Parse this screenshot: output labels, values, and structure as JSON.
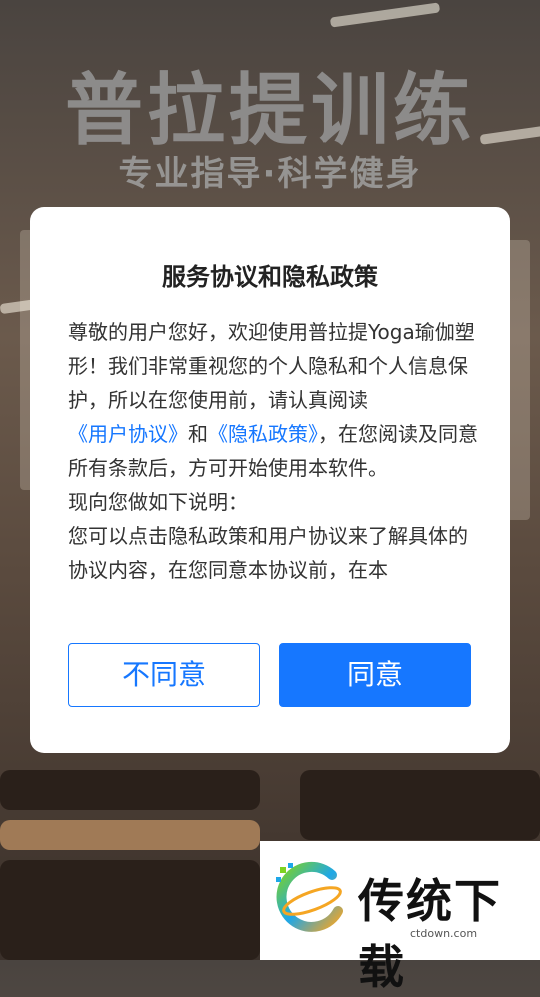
{
  "hero": {
    "title": "普拉提训练",
    "subtitle": "专业指导·科学健身"
  },
  "dialog": {
    "title": "服务协议和隐私政策",
    "paragraph1_a": "尊敬的用户您好，欢迎使用普拉提Yoga瑜伽塑形！我们非常重视您的个人隐私和个人信息保护，所以在您使用前，请认真阅读",
    "user_agreement_link": "《用户协议》",
    "paragraph1_and": "和",
    "privacy_policy_link": "《隐私政策》",
    "paragraph1_b": "，在您阅读及同意所有条款后，方可开始使用本软件。",
    "paragraph2": "现向您做如下说明：",
    "paragraph3": "您可以点击隐私政策和用户协议来了解具体的协议内容，在您同意本协议前，在本",
    "disagree_label": "不同意",
    "agree_label": "同意",
    "accent_color": "#1677ff"
  },
  "watermark": {
    "text": "传统下载",
    "url": "ctdown.com"
  }
}
